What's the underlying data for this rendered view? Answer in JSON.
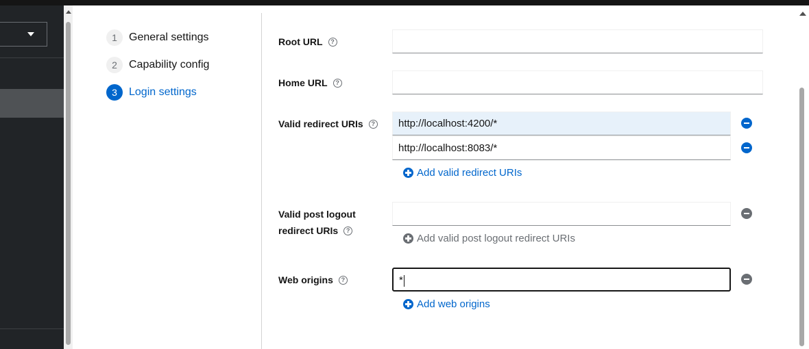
{
  "wizard": {
    "steps": [
      {
        "number": "1",
        "label": "General settings"
      },
      {
        "number": "2",
        "label": "Capability config"
      },
      {
        "number": "3",
        "label": "Login settings"
      }
    ],
    "current_step": 3
  },
  "form": {
    "root_url": {
      "label": "Root URL",
      "value": ""
    },
    "home_url": {
      "label": "Home URL",
      "value": ""
    },
    "valid_redirect_uris": {
      "label": "Valid redirect URIs",
      "values": [
        "http://localhost:4200/*",
        "http://localhost:8083/*"
      ],
      "add_label": "Add valid redirect URIs"
    },
    "valid_post_logout": {
      "label_line1": "Valid post logout",
      "label_line2": "redirect URIs",
      "value": "",
      "add_label": "Add valid post logout redirect URIs"
    },
    "web_origins": {
      "label": "Web origins",
      "value": "*",
      "add_label": "Add web origins"
    }
  },
  "icons": {
    "help": "question-circle-icon",
    "remove": "minus-circle-icon",
    "add": "plus-circle-icon",
    "caret": "caret-down-icon"
  },
  "colors": {
    "accent": "#0066cc",
    "disabled": "#6a6e73",
    "sidebar": "#212427",
    "hover_input": "#e7f1fa"
  },
  "help_glyph": "?"
}
